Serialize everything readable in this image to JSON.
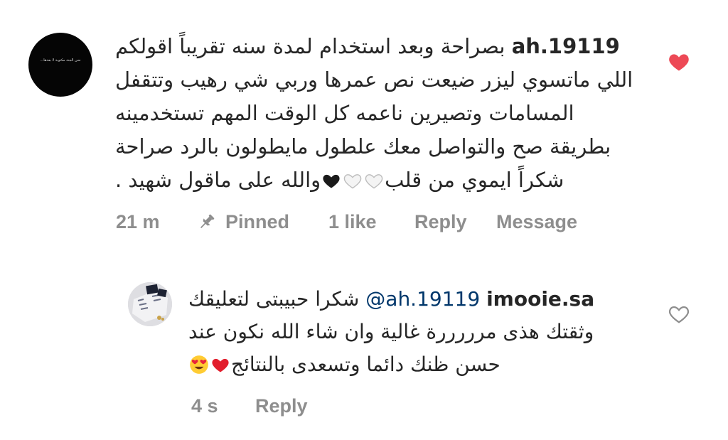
{
  "comment": {
    "username": "ah.19119",
    "avatar_text": "نحن الجنة مكتوبة لا بعدها...",
    "line1": "بصراحة وبعد استخدام لمدة سنه تقريباً  اقولكم",
    "line2": "اللي ماتسوي ليزر ضيعت نص عمرها وربي شي رهيب وتتقفل",
    "line3": "المسامات وتصيرين ناعمه كل الوقت المهم تستخدمينه",
    "line4": "بطريقة صح والتواصل معك علطول مايطولون بالرد صراحة",
    "line5_start": "شكراً ايموي من قلب",
    "line5_end": "والله على ماقول شهيد .",
    "time": "21 m",
    "pinned_label": "Pinned",
    "likes": "1 like",
    "reply_label": "Reply",
    "message_label": "Message",
    "liked": true,
    "like_color": "#ed4956"
  },
  "reply": {
    "username": "imooie.sa",
    "mention": "@ah.19119",
    "line1_text": "شكرا حبيبتى لتعليقك",
    "line2": "وثقتك هذى مرررررة غالية وان شاء الله نكون عند",
    "line3_text": "حسن ظنك دائما وتسعدى بالنتائج",
    "time": "4 s",
    "reply_label": "Reply",
    "liked": false
  },
  "colors": {
    "meta_gray": "#8e8e8e",
    "text": "#262626",
    "mention": "#00376b"
  },
  "icons": [
    "avatar",
    "pin-icon",
    "heart-filled-icon",
    "heart-outline-icon",
    "white-heart-emoji",
    "black-heart-emoji",
    "red-heart-emoji",
    "heart-eyes-emoji"
  ]
}
